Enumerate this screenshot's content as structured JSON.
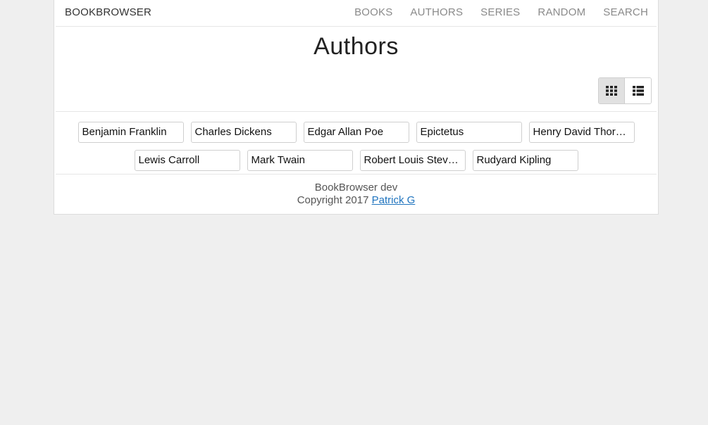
{
  "navbar": {
    "brand": "BOOKBROWSER",
    "links": [
      "BOOKS",
      "AUTHORS",
      "SERIES",
      "RANDOM",
      "SEARCH"
    ]
  },
  "page": {
    "title": "Authors"
  },
  "view_toggle": {
    "active": "grid",
    "options": [
      "grid-view-icon",
      "list-view-icon"
    ]
  },
  "authors": {
    "row1": [
      "Benjamin Franklin",
      "Charles Dickens",
      "Edgar Allan Poe",
      "Epictetus",
      "Henry David Thoreau"
    ],
    "row2": [
      "Lewis Carroll",
      "Mark Twain",
      "Robert Louis Stevenson",
      "Rudyard Kipling"
    ]
  },
  "footer": {
    "version": "BookBrowser dev",
    "copyright": "Copyright 2017",
    "author_link": "Patrick G"
  },
  "colors": {
    "background": "#efefef",
    "link": "#1e73be",
    "nav_text": "#8a8a8a",
    "active_toggle": "#e1e1e1"
  }
}
